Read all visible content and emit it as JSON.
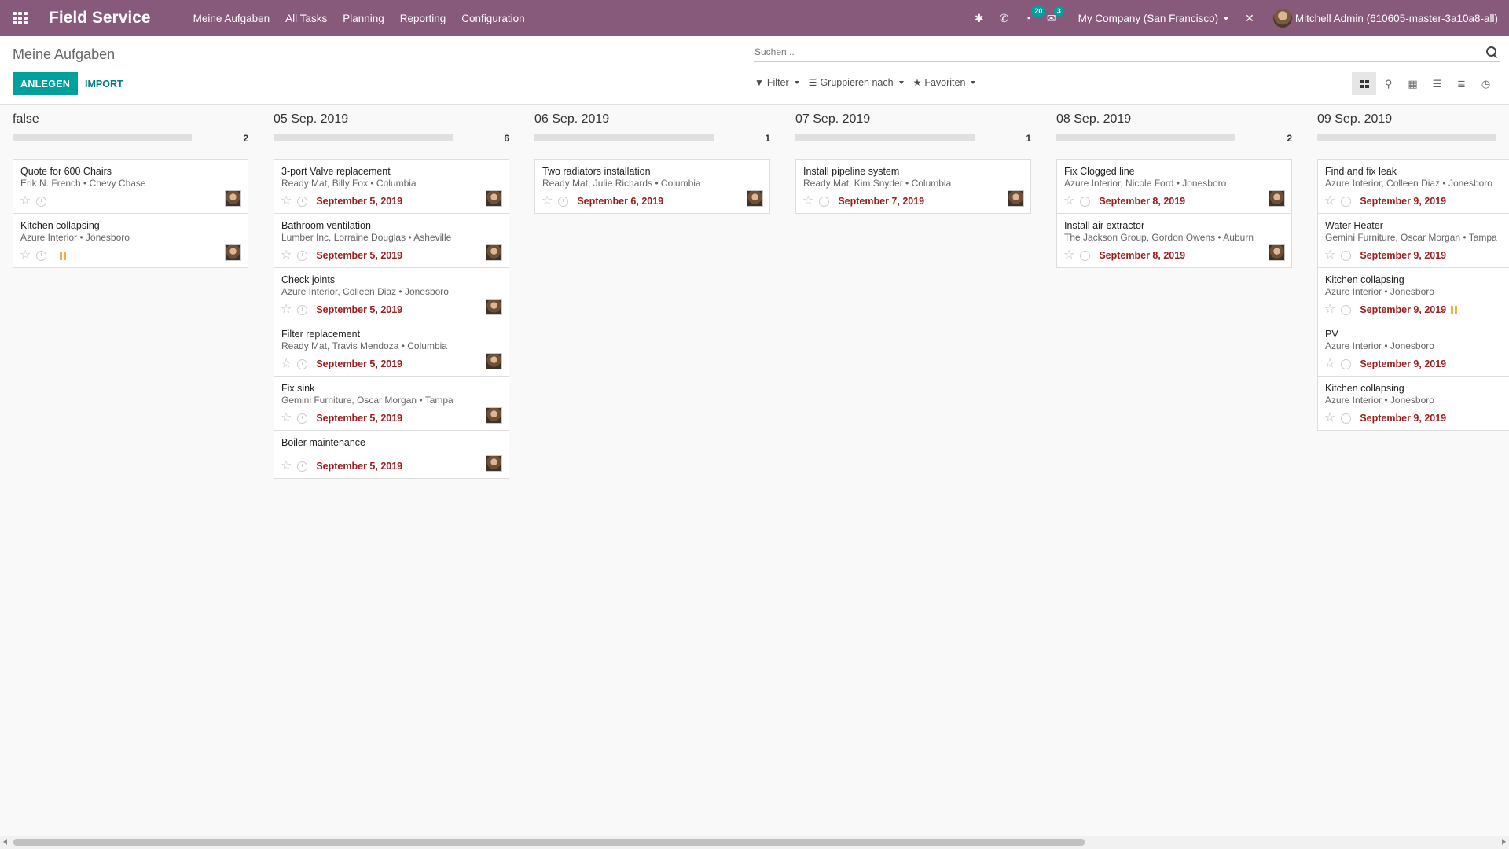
{
  "navbar": {
    "brand": "Field Service",
    "menu": [
      "Meine Aufgaben",
      "All Tasks",
      "Planning",
      "Reporting",
      "Configuration"
    ],
    "activity_badge": "20",
    "messages_badge": "3",
    "company": "My Company (San Francisco)",
    "user": "Mitchell Admin (610605-master-3a10a8-all)"
  },
  "control_panel": {
    "title": "Meine Aufgaben",
    "create_label": "ANLEGEN",
    "import_label": "IMPORT",
    "search_placeholder": "Suchen...",
    "filter_label": "Filter",
    "groupby_label": "Gruppieren nach",
    "favorites_label": "Favoriten"
  },
  "columns": [
    {
      "title": "false",
      "count": "2",
      "cards": [
        {
          "title": "Quote for 600 Chairs",
          "subtitle": "Erik N. French • Chevy Chase",
          "deadline": "",
          "blocked": false
        },
        {
          "title": "Kitchen collapsing",
          "subtitle": "Azure Interior • Jonesboro",
          "deadline": "",
          "blocked": true
        }
      ]
    },
    {
      "title": "05 Sep. 2019",
      "count": "6",
      "cards": [
        {
          "title": "3-port Valve replacement",
          "subtitle": "Ready Mat, Billy Fox • Columbia",
          "deadline": "September 5, 2019",
          "blocked": false
        },
        {
          "title": "Bathroom ventilation",
          "subtitle": "Lumber Inc, Lorraine Douglas • Asheville",
          "deadline": "September 5, 2019",
          "blocked": false
        },
        {
          "title": "Check joints",
          "subtitle": "Azure Interior, Colleen Diaz • Jonesboro",
          "deadline": "September 5, 2019",
          "blocked": false
        },
        {
          "title": "Filter replacement",
          "subtitle": "Ready Mat, Travis Mendoza • Columbia",
          "deadline": "September 5, 2019",
          "blocked": false
        },
        {
          "title": "Fix sink",
          "subtitle": "Gemini Furniture, Oscar Morgan • Tampa",
          "deadline": "September 5, 2019",
          "blocked": false
        },
        {
          "title": "Boiler maintenance",
          "subtitle": "",
          "deadline": "September 5, 2019",
          "blocked": false
        }
      ]
    },
    {
      "title": "06 Sep. 2019",
      "count": "1",
      "cards": [
        {
          "title": "Two radiators installation",
          "subtitle": "Ready Mat, Julie Richards • Columbia",
          "deadline": "September 6, 2019",
          "blocked": false
        }
      ]
    },
    {
      "title": "07 Sep. 2019",
      "count": "1",
      "cards": [
        {
          "title": "Install pipeline system",
          "subtitle": "Ready Mat, Kim Snyder • Columbia",
          "deadline": "September 7, 2019",
          "blocked": false
        }
      ]
    },
    {
      "title": "08 Sep. 2019",
      "count": "2",
      "cards": [
        {
          "title": "Fix Clogged line",
          "subtitle": "Azure Interior, Nicole Ford • Jonesboro",
          "deadline": "September 8, 2019",
          "blocked": false
        },
        {
          "title": "Install air extractor",
          "subtitle": "The Jackson Group, Gordon Owens • Auburn",
          "deadline": "September 8, 2019",
          "blocked": false
        }
      ]
    },
    {
      "title": "09 Sep. 2019",
      "count": "",
      "cards": [
        {
          "title": "Find and fix leak",
          "subtitle": "Azure Interior, Colleen Diaz • Jonesboro",
          "deadline": "September 9, 2019",
          "blocked": false
        },
        {
          "title": "Water Heater",
          "subtitle": "Gemini Furniture, Oscar Morgan • Tampa",
          "deadline": "September 9, 2019",
          "blocked": false
        },
        {
          "title": "Kitchen collapsing",
          "subtitle": "Azure Interior • Jonesboro",
          "deadline": "September 9, 2019",
          "blocked": true
        },
        {
          "title": "PV",
          "subtitle": "Azure Interior • Jonesboro",
          "deadline": "September 9, 2019",
          "blocked": false
        },
        {
          "title": "Kitchen collapsing",
          "subtitle": "Azure Interior • Jonesboro",
          "deadline": "September 9, 2019",
          "blocked": false
        }
      ]
    }
  ],
  "icons": {
    "apps": "apps-grid-icon",
    "bug": "bug-icon",
    "phone": "phone-icon",
    "activity": "clock-activity-icon",
    "messages": "chat-icon",
    "close": "close-icon",
    "star": "star-icon",
    "clock": "clock-icon",
    "pause": "blocked-icon",
    "search": "search-icon"
  },
  "colors": {
    "brand": "#875a7b",
    "accent": "#00a09d",
    "deadline": "#a31b1b",
    "blocked": "#f0ad4e"
  }
}
